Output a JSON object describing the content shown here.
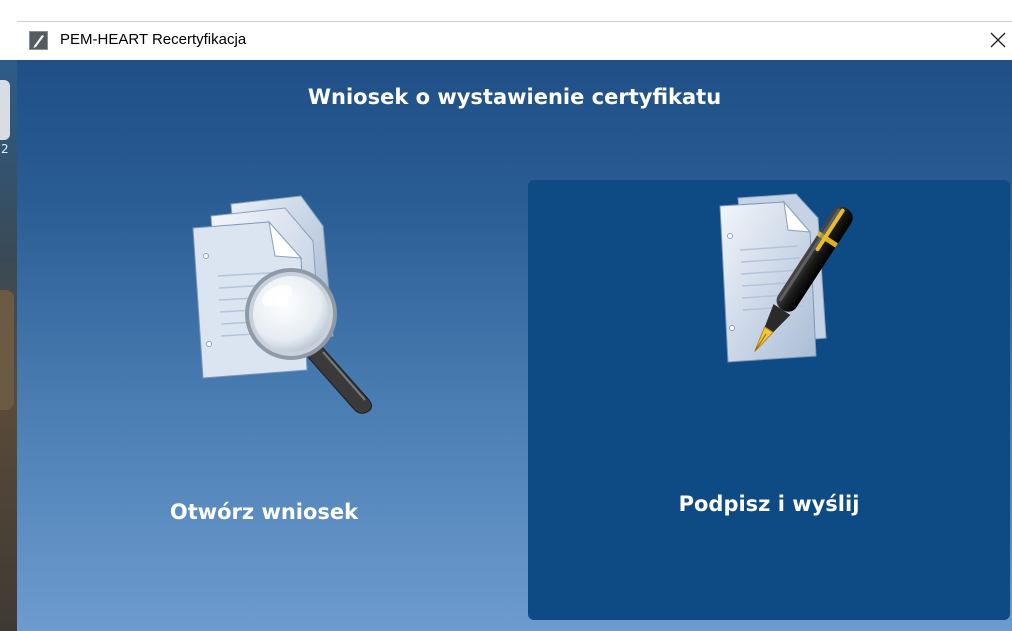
{
  "window": {
    "title": "PEM-HEART Recertyfikacja",
    "close_icon": "close-icon"
  },
  "desktop": {
    "partial_text": "2"
  },
  "main": {
    "heading": "Wniosek o wystawienie certyfikatu",
    "actions": [
      {
        "label": "Otwórz wniosek",
        "icon": "document-magnifier-icon"
      },
      {
        "label": "Podpisz i wyślij",
        "icon": "document-pen-icon"
      }
    ]
  },
  "colors": {
    "content_top": "#1f4f86",
    "content_bottom": "#6d9bcf",
    "selected_card": "#0e4a84",
    "text": "#ffffff"
  }
}
